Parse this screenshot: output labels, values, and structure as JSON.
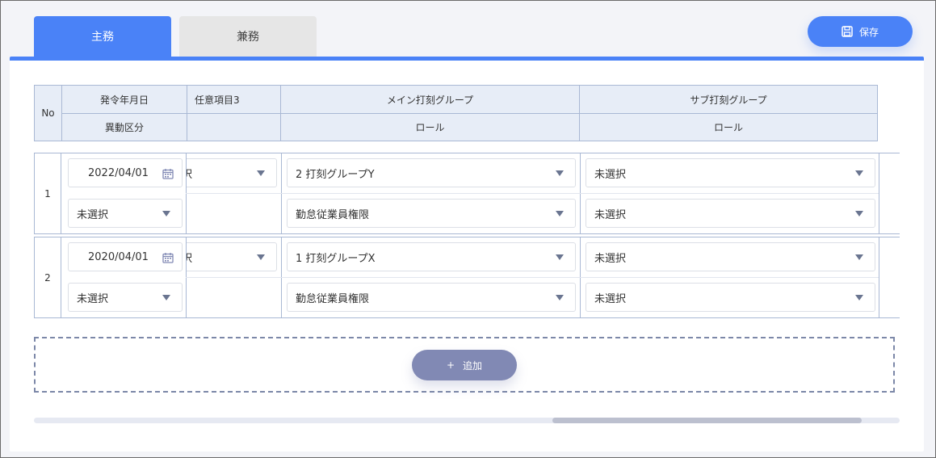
{
  "tabs": [
    {
      "label": "主務",
      "active": true
    },
    {
      "label": "兼務",
      "active": false
    }
  ],
  "toolbar": {
    "save_label": "保存",
    "save_icon": "floppy-disk-icon"
  },
  "header": {
    "no": "No",
    "issue_date": "発令年月日",
    "transfer_type": "異動区分",
    "custom_item": "任意項目3",
    "main_group": "メイン打刻グループ",
    "main_role": "ロール",
    "sub_group": "サブ打刻グループ",
    "sub_role": "ロール"
  },
  "rows": [
    {
      "no": "1",
      "date": "2022/04/01",
      "custom_item": "選択",
      "transfer_type": "未選択",
      "main_group": "2 打刻グループY",
      "main_role": "勤怠従業員権限",
      "sub_group": "未選択",
      "sub_role": "未選択"
    },
    {
      "no": "2",
      "date": "2020/04/01",
      "custom_item": "選択",
      "transfer_type": "未選択",
      "main_group": "1 打刻グループX",
      "main_role": "勤怠従業員権限",
      "sub_group": "未選択",
      "sub_role": "未選択"
    }
  ],
  "add_button": {
    "label": "追加",
    "icon": "+"
  },
  "colors": {
    "accent": "#4a82f7",
    "header_bg": "#e7edf7",
    "add_button": "#8189b4"
  }
}
